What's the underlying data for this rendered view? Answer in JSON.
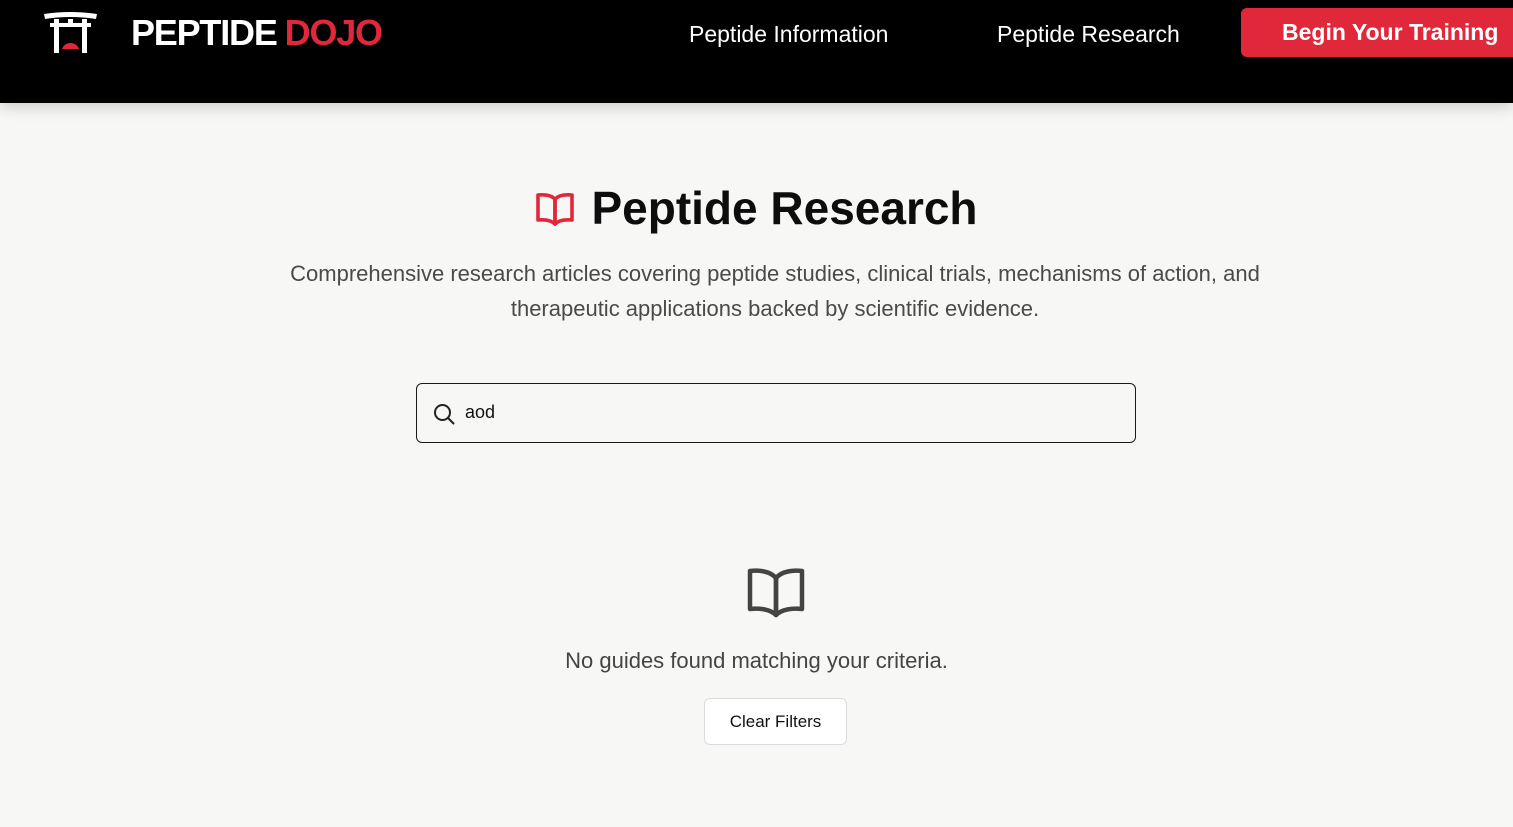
{
  "colors": {
    "accent": "#e0283a",
    "nav_bg": "#000000",
    "page_bg": "#f7f7f5"
  },
  "header": {
    "logo_icon": "torii-gate-icon",
    "brand_word_1": "PEPTIDE",
    "brand_word_2": "DOJO",
    "nav": [
      {
        "label": "Peptide Information"
      },
      {
        "label": "Peptide Research"
      }
    ],
    "cta_label": "Begin Your Training"
  },
  "hero": {
    "icon": "open-book-icon",
    "title": "Peptide Research",
    "subtitle": "Comprehensive research articles covering peptide studies, clinical trials, mechanisms of action, and therapeutic applications backed by scientific evidence."
  },
  "search": {
    "icon": "search-icon",
    "value": "aod"
  },
  "empty_state": {
    "icon": "open-book-icon",
    "message": "No guides found matching your criteria.",
    "clear_label": "Clear Filters"
  }
}
